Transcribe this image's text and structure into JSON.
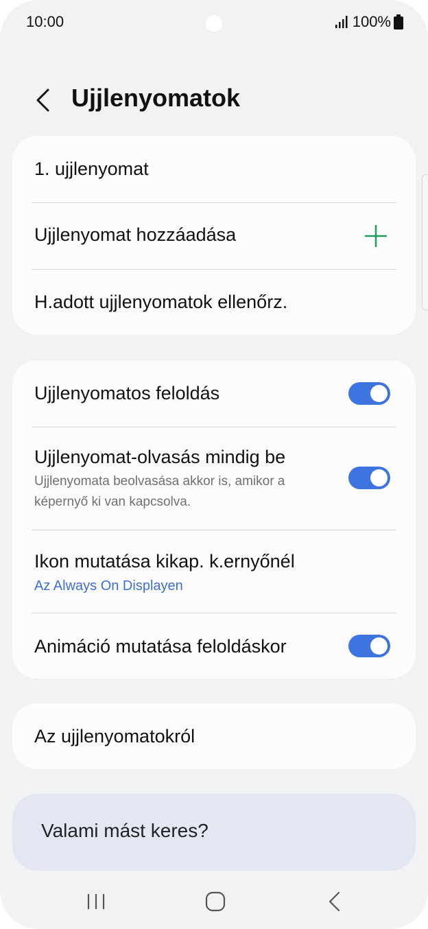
{
  "status_bar": {
    "time": "10:00",
    "battery_percent": "100%"
  },
  "header": {
    "title": "Ujjlenyomatok"
  },
  "fingerprints_card": {
    "items": [
      {
        "label": "1. ujjlenyomat"
      },
      {
        "label": "Ujjlenyomat hozzáadása",
        "icon": "plus-icon"
      },
      {
        "label": "H.adott ujjlenyomatok ellenőrz."
      }
    ]
  },
  "settings_card": {
    "items": [
      {
        "label": "Ujjlenyomatos feloldás",
        "toggle": true
      },
      {
        "label": "Ujjlenyomat-olvasás mindig be",
        "sub": "Ujjlenyomata beolvasása akkor is, amikor a képernyő ki van kapcsolva.",
        "toggle": true
      },
      {
        "label": "Ikon mutatása kikap. k.ernyőnél",
        "sub": "Az Always On Displayen"
      },
      {
        "label": "Animáció mutatása feloldáskor",
        "toggle": true
      }
    ]
  },
  "about_card": {
    "label": "Az ujjlenyomatokról"
  },
  "suggest_card": {
    "label": "Valami mást keres?"
  },
  "colors": {
    "accent_blue": "#3e74e0",
    "plus_green": "#1f9d5a",
    "link_blue": "#3c6fd4"
  }
}
